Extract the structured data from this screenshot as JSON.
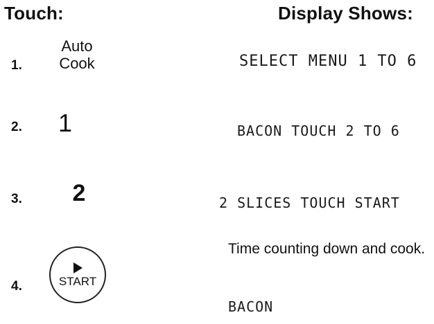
{
  "headers": {
    "touch": "Touch:",
    "display": "Display Shows:"
  },
  "steps": [
    {
      "number": "1.",
      "key": "Auto Cook",
      "display": "SELECT MENU 1 TO 6"
    },
    {
      "number": "2.",
      "key": "1",
      "display": "BACON TOUCH 2 TO 6"
    },
    {
      "number": "3.",
      "key": "2",
      "display": "2 SLICES TOUCH START"
    },
    {
      "number": "4.",
      "key": "START",
      "key_icon": "play-icon",
      "description": "Time counting down and cook.",
      "display": "BACON"
    }
  ]
}
